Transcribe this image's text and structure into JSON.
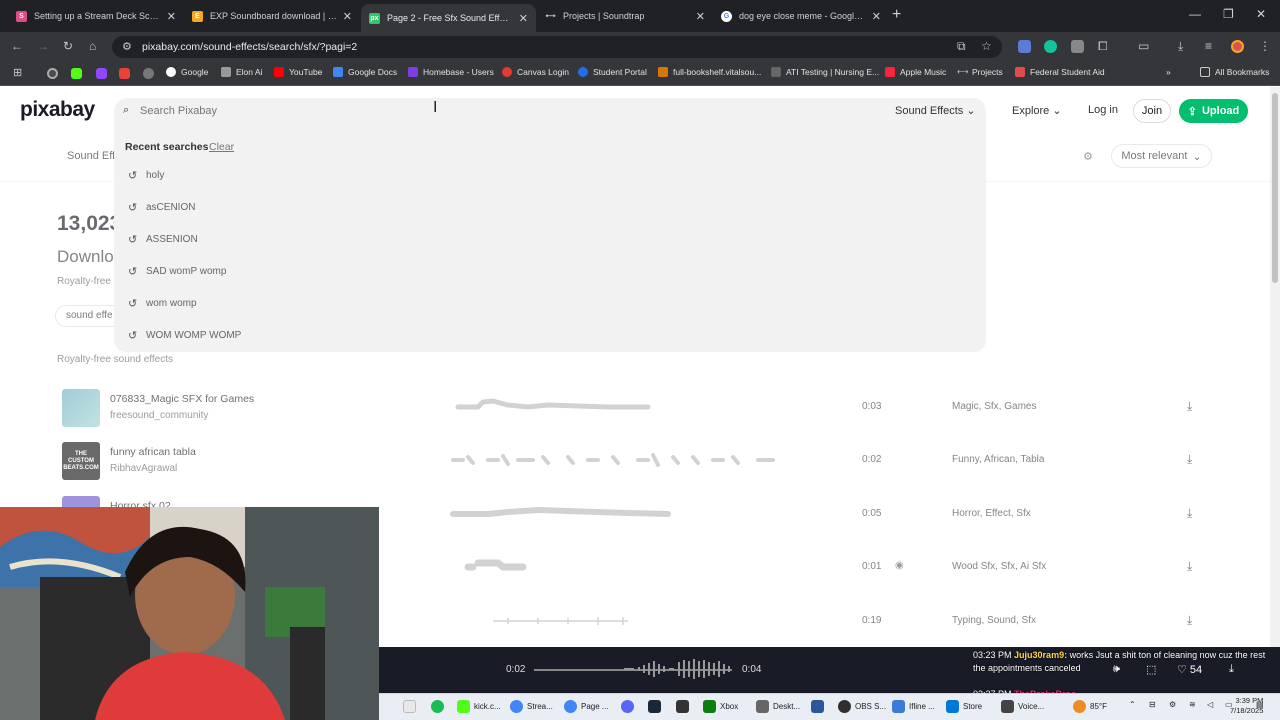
{
  "browser": {
    "tabs": [
      {
        "title": "Setting up a Stream Deck Screens",
        "color": "#e04b8a",
        "glyph": "S"
      },
      {
        "title": "EXP Soundboard download | Sour",
        "color": "#f5a623",
        "glyph": "E"
      },
      {
        "title": "Page 2 - Free Sfx Sound Effects Do",
        "color": "#2ec866",
        "glyph": "px"
      },
      {
        "title": "Projects | Soundtrap",
        "color": "#9aa0a6",
        "glyph": "ST"
      },
      {
        "title": "dog eye close meme - Google Sea",
        "color": "#4285f4",
        "glyph": "G"
      }
    ],
    "url": "pixabay.com/sound-effects/search/sfx/?pagi=2",
    "bookmarks": [
      {
        "label": "Google",
        "color": "#4285f4"
      },
      {
        "label": "Elon Ai",
        "color": "#999999"
      },
      {
        "label": "YouTube",
        "color": "#ff0000"
      },
      {
        "label": "Google Docs",
        "color": "#4285f4"
      },
      {
        "label": "Homebase - Users",
        "color": "#7b3fe4"
      },
      {
        "label": "Canvas Login",
        "color": "#e33b2e"
      },
      {
        "label": "Student Portal",
        "color": "#1f6feb"
      },
      {
        "label": "full-bookshelf.vitalsou...",
        "color": "#d97706"
      },
      {
        "label": "ATI Testing | Nursing E...",
        "color": "#666666"
      },
      {
        "label": "Apple Music",
        "color": "#fa243c"
      },
      {
        "label": "Projects",
        "color": "#9aa0a6"
      },
      {
        "label": "Federal Student Aid",
        "color": "#e04b4b"
      }
    ],
    "all_bookmarks": "All Bookmarks"
  },
  "header": {
    "logo": "pixabay",
    "search_placeholder": "Search Pixabay",
    "media_type": "Sound Effects",
    "explore": "Explore",
    "login": "Log in",
    "join": "Join",
    "upload": "Upload"
  },
  "recent": {
    "heading": "Recent searches",
    "clear": "Clear",
    "items": [
      "holy",
      "asCENION",
      "ASSENION",
      "SAD womP womp",
      "wom womp",
      "WOM WOMP WOMP"
    ]
  },
  "subnav": {
    "sound_effects": "Sound Effe",
    "sort": "Most relevant"
  },
  "results": {
    "count": "13,023",
    "heading": "Downlo",
    "subtitle": "Royalty-free",
    "chip": "sound effe",
    "section_label": "Royalty-free sound effects",
    "rows": [
      {
        "title": "076833_Magic SFX for Games",
        "author": "freesound_community",
        "duration": "0:03",
        "tags": "Magic, Sfx, Games",
        "thumb": "#7ab8c7"
      },
      {
        "title": "funny african tabla",
        "author": "RibhavAgrawal",
        "duration": "0:02",
        "tags": "Funny, African, Tabla",
        "thumb": "#222222",
        "thumb_text": "THE CUSTOM BEATS.COM"
      },
      {
        "title": "Horror sfx 02",
        "author": "",
        "duration": "0:05",
        "tags": "Horror, Effect, Sfx",
        "thumb": "#6a5acd"
      },
      {
        "title": "",
        "author": "",
        "duration": "0:01",
        "tags": "Wood Sfx, Sfx, Ai Sfx",
        "thumb": ""
      },
      {
        "title": "",
        "author": "",
        "duration": "0:19",
        "tags": "Typing, Sound, Sfx",
        "thumb": ""
      }
    ]
  },
  "player": {
    "current": "0:02",
    "total": "0:04",
    "likes": "54"
  },
  "chat": {
    "time1": "03:23 PM",
    "user1": "Juju30ram9:",
    "msg1": "works Jsut a shit ton of cleaning now cuz the rest the appointments canceled",
    "time2": "03:27 PM",
    "user2": "TheBrokeBroc"
  },
  "taskbar": {
    "items": [
      {
        "label": "",
        "color": "#e8e8e8"
      },
      {
        "label": "",
        "color": "#1db954"
      },
      {
        "label": "kick.c...",
        "color": "#53fc18"
      },
      {
        "label": "Strea...",
        "color": "#4285f4"
      },
      {
        "label": "Page ...",
        "color": "#4285f4"
      },
      {
        "label": "",
        "color": "#5865f2"
      },
      {
        "label": "",
        "color": "#1b2838"
      },
      {
        "label": "",
        "color": "#333333"
      },
      {
        "label": "Xbox",
        "color": "#107c10"
      },
      {
        "label": "Deskt...",
        "color": "#666666"
      },
      {
        "label": "",
        "color": "#2b579a"
      },
      {
        "label": "OBS S...",
        "color": "#302e31"
      },
      {
        "label": "Ifline ...",
        "color": "#3a7bd5"
      },
      {
        "label": "Store",
        "color": "#0078d4"
      },
      {
        "label": "Voice...",
        "color": "#444444"
      }
    ],
    "temp": "85°F",
    "time": "3:39 PM",
    "date": "7/18/2025"
  }
}
